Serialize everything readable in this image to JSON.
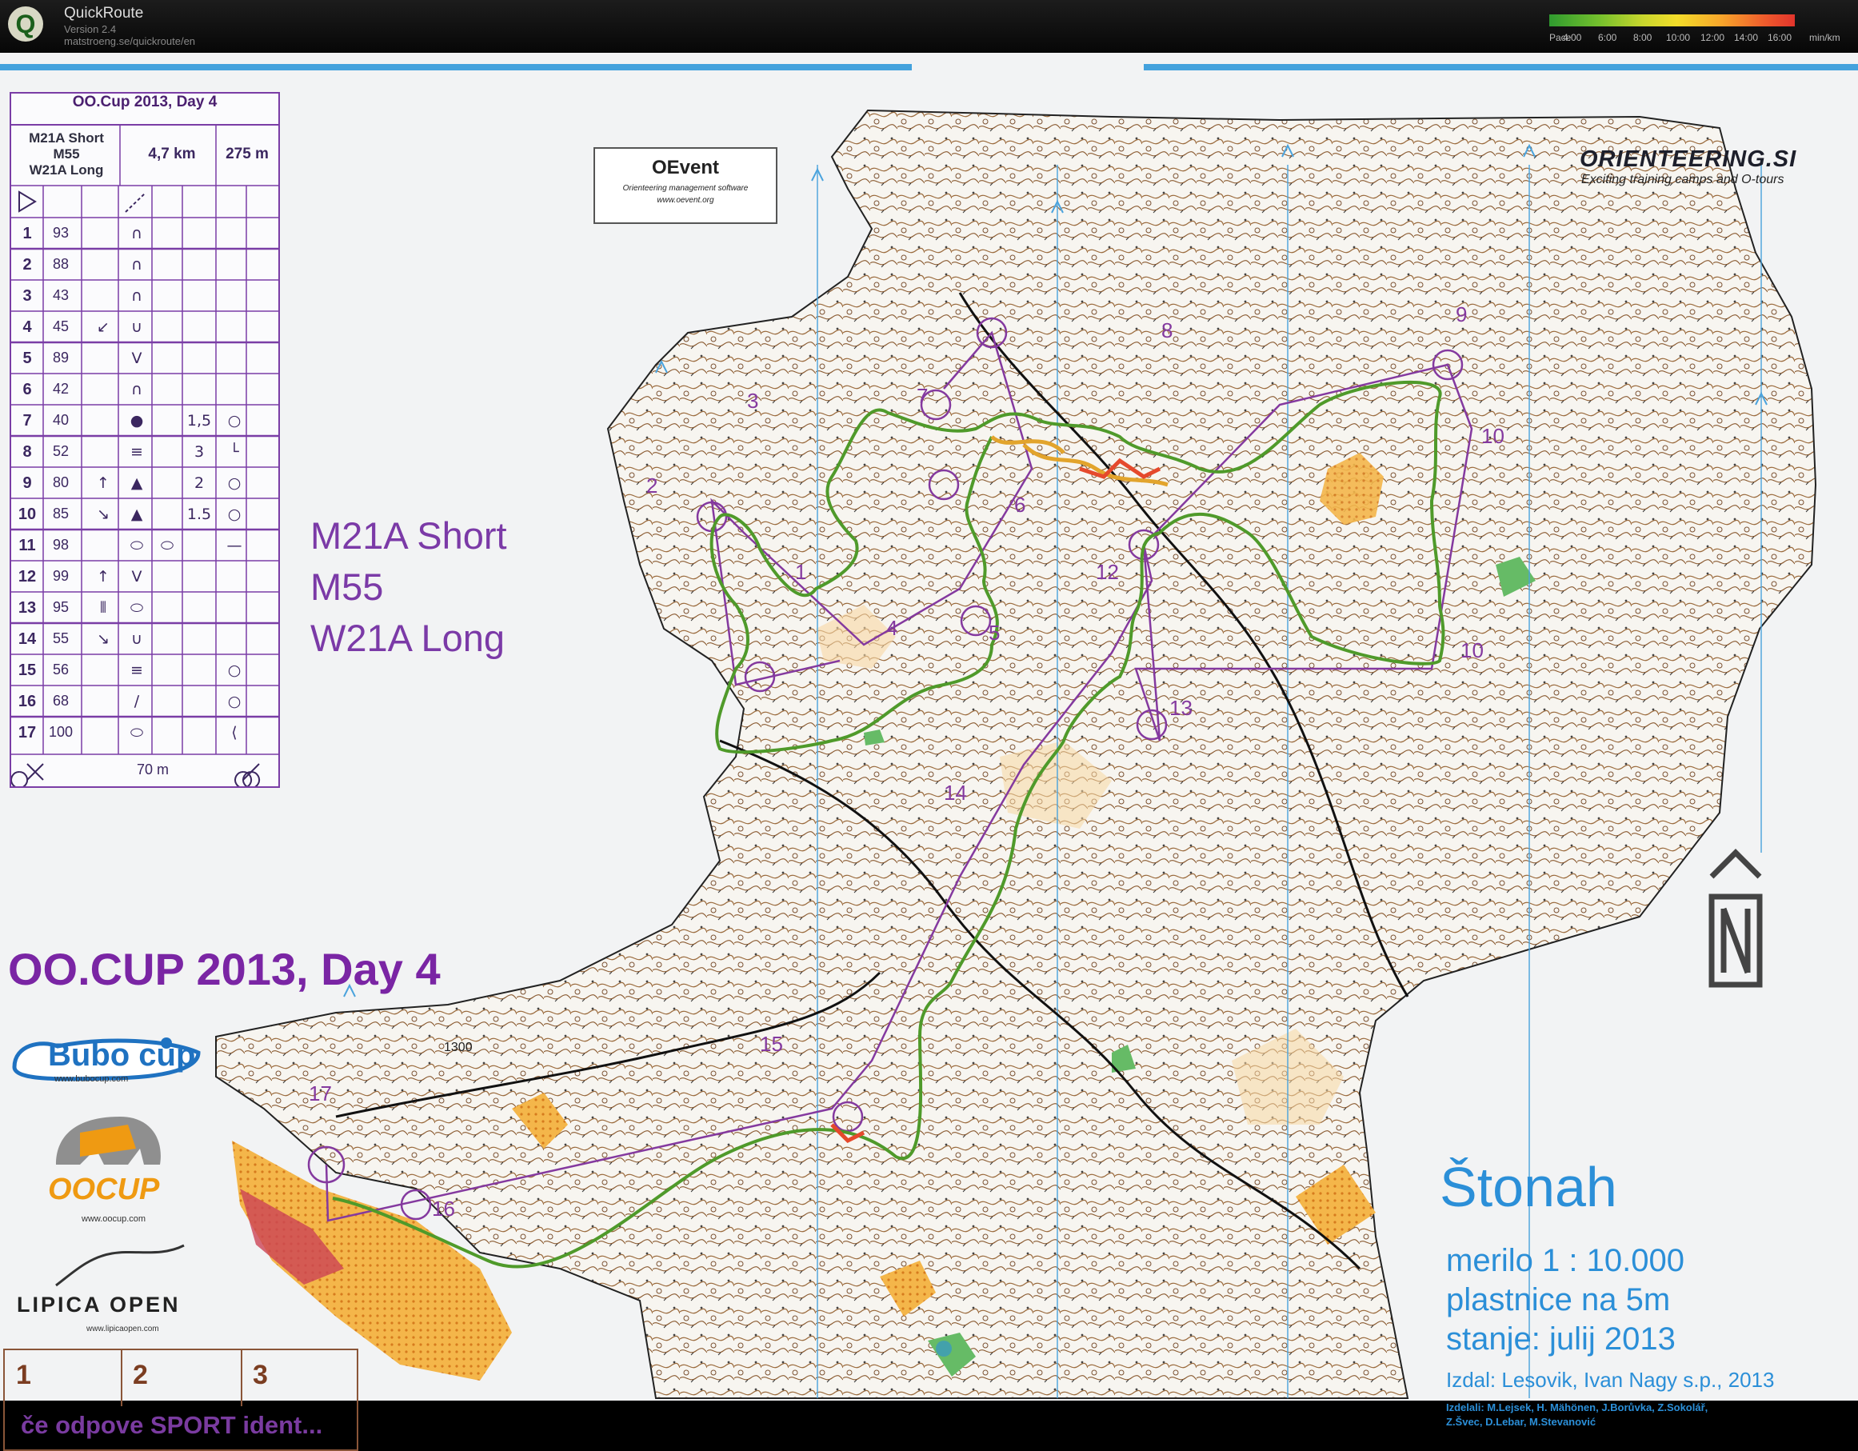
{
  "app": {
    "name": "QuickRoute",
    "version": "Version 2.4",
    "url": "matstroeng.se/quickroute/en",
    "pace_label": "Pace",
    "pace_ticks": [
      "4:00",
      "6:00",
      "8:00",
      "10:00",
      "12:00",
      "14:00",
      "16:00"
    ],
    "pace_unit": "min/km"
  },
  "control_card": {
    "title": "OO.Cup 2013, Day 4",
    "classes": [
      "M21A Short",
      "M55",
      "W21A Long"
    ],
    "length": "4,7 km",
    "climb": "275 m",
    "footer": "70 m",
    "controls": [
      {
        "num": "1",
        "code": "93",
        "sym": "∩"
      },
      {
        "num": "2",
        "code": "88",
        "sym": "∩"
      },
      {
        "num": "3",
        "code": "43",
        "sym": "∩"
      },
      {
        "num": "4",
        "code": "45",
        "dir": "↙",
        "sym": "∪"
      },
      {
        "num": "5",
        "code": "89",
        "sym": "V"
      },
      {
        "num": "6",
        "code": "42",
        "sym": "∩"
      },
      {
        "num": "7",
        "code": "40",
        "sym": "●",
        "dim": "1,5",
        "place": "○"
      },
      {
        "num": "8",
        "code": "52",
        "sym": "≡",
        "dim": "3",
        "place": "└"
      },
      {
        "num": "9",
        "code": "80",
        "dir": "↑",
        "sym": "▲",
        "dim": "2",
        "place": "○"
      },
      {
        "num": "10",
        "code": "85",
        "dir": "↘",
        "sym": "▲",
        "dim": "1.5",
        "place": "○"
      },
      {
        "num": "11",
        "code": "98",
        "sym": "⬭",
        "extra": "⬭",
        "place": "—"
      },
      {
        "num": "12",
        "code": "99",
        "dir": "↑",
        "sym": "V"
      },
      {
        "num": "13",
        "code": "95",
        "dir": "⫴",
        "sym": "⬭"
      },
      {
        "num": "14",
        "code": "55",
        "dir": "↘",
        "sym": "∪"
      },
      {
        "num": "15",
        "code": "56",
        "sym": "≡",
        "place": "○"
      },
      {
        "num": "16",
        "code": "68",
        "sym": "∕",
        "place": "○"
      },
      {
        "num": "17",
        "code": "100",
        "sym": "⬭",
        "place": "⟨"
      }
    ]
  },
  "class_labels": [
    "M21A Short",
    "M55",
    "W21A Long"
  ],
  "event_title": "OO.CUP 2013, Day 4",
  "oevent": {
    "name": "OEvent",
    "tagline": "Orienteering management software",
    "url": "www.oevent.org"
  },
  "orienteering_si": {
    "logo": "ORIENTEERING.SI",
    "tagline": "Exciting training camps and O-tours"
  },
  "sponsors": {
    "bubo": "Bubo cup",
    "bubo_url": "www.bubocup.com",
    "oocup": "OOCUP",
    "oocup_url": "www.oocup.com",
    "lipica": "LIPICA OPEN",
    "lipica_url": "www.lipicaopen.com"
  },
  "sport_ident": {
    "numbers": [
      "1",
      "2",
      "3"
    ],
    "text": "če odpove SPORT ident..."
  },
  "map_info": {
    "name": "Štonah",
    "scale": "merilo 1 : 10.000",
    "contours": "plastnice na 5m",
    "status": "stanje: julij 2013",
    "publisher": "Izdal: Lesovik, Ivan Nagy s.p., 2013",
    "credits_1": "Izdelali: M.Lejsek, H. Mähönen, J.Borůvka, Z.Sokolář,",
    "credits_2": "Z.Švec, D.Lebar, M.Stevanović"
  },
  "control_numbers": [
    "1",
    "2",
    "3",
    "4",
    "5",
    "6",
    "7",
    "8",
    "9",
    "10",
    "10",
    "12",
    "13",
    "14",
    "15",
    "16",
    "17"
  ],
  "contour_label": "1300",
  "colors": {
    "course": "#84399f",
    "route": "#4f9a2a",
    "water": "#2b8fd8",
    "open_land": "#f0a830"
  }
}
